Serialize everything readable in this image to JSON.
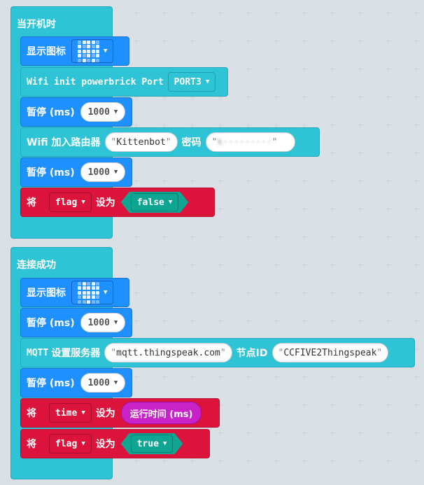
{
  "event1": {
    "label": "当开机时",
    "show_icon": "显示图标",
    "wifi_init": "Wifi init powerbrick Port",
    "port": "PORT3",
    "pause_label": "暂停 (ms)",
    "pause_value": "1000",
    "wifi_join": "Wifi 加入路由器",
    "ssid": "Kittenbot",
    "password_label": "密码",
    "password": "k·········",
    "pause2_value": "1000",
    "set_label": "将",
    "var": "flag",
    "set_to": "设为",
    "bool": "false",
    "icon_pattern": [
      0,
      1,
      1,
      1,
      0,
      1,
      0,
      1,
      0,
      1,
      1,
      1,
      1,
      1,
      1,
      1,
      0,
      1,
      0,
      1,
      0,
      1,
      0,
      1,
      0
    ]
  },
  "event2": {
    "label": "连接成功",
    "show_icon": "显示图标",
    "pause_label": "暂停 (ms)",
    "pause_value": "1000",
    "mqtt_prefix": "MQTT",
    "mqtt_set": "设置服务器",
    "server": "mqtt.thingspeak.com",
    "node_label": "节点ID",
    "node_id": "CCFIVE2Thingspeak",
    "pause2_value": "1000",
    "set_label": "将",
    "var_time": "time",
    "set_to": "设为",
    "runtime": "运行时间 (ms)",
    "var_flag": "flag",
    "bool": "true",
    "icon_pattern": [
      0,
      1,
      0,
      1,
      0,
      1,
      1,
      1,
      1,
      1,
      1,
      1,
      1,
      1,
      1,
      0,
      1,
      1,
      1,
      0,
      0,
      0,
      1,
      0,
      0
    ]
  },
  "colors": {
    "event": "#2ec4d6",
    "basic": "#1e90ff",
    "variable": "#dc143c",
    "logic": "#0fa593",
    "input": "#c822c8"
  }
}
